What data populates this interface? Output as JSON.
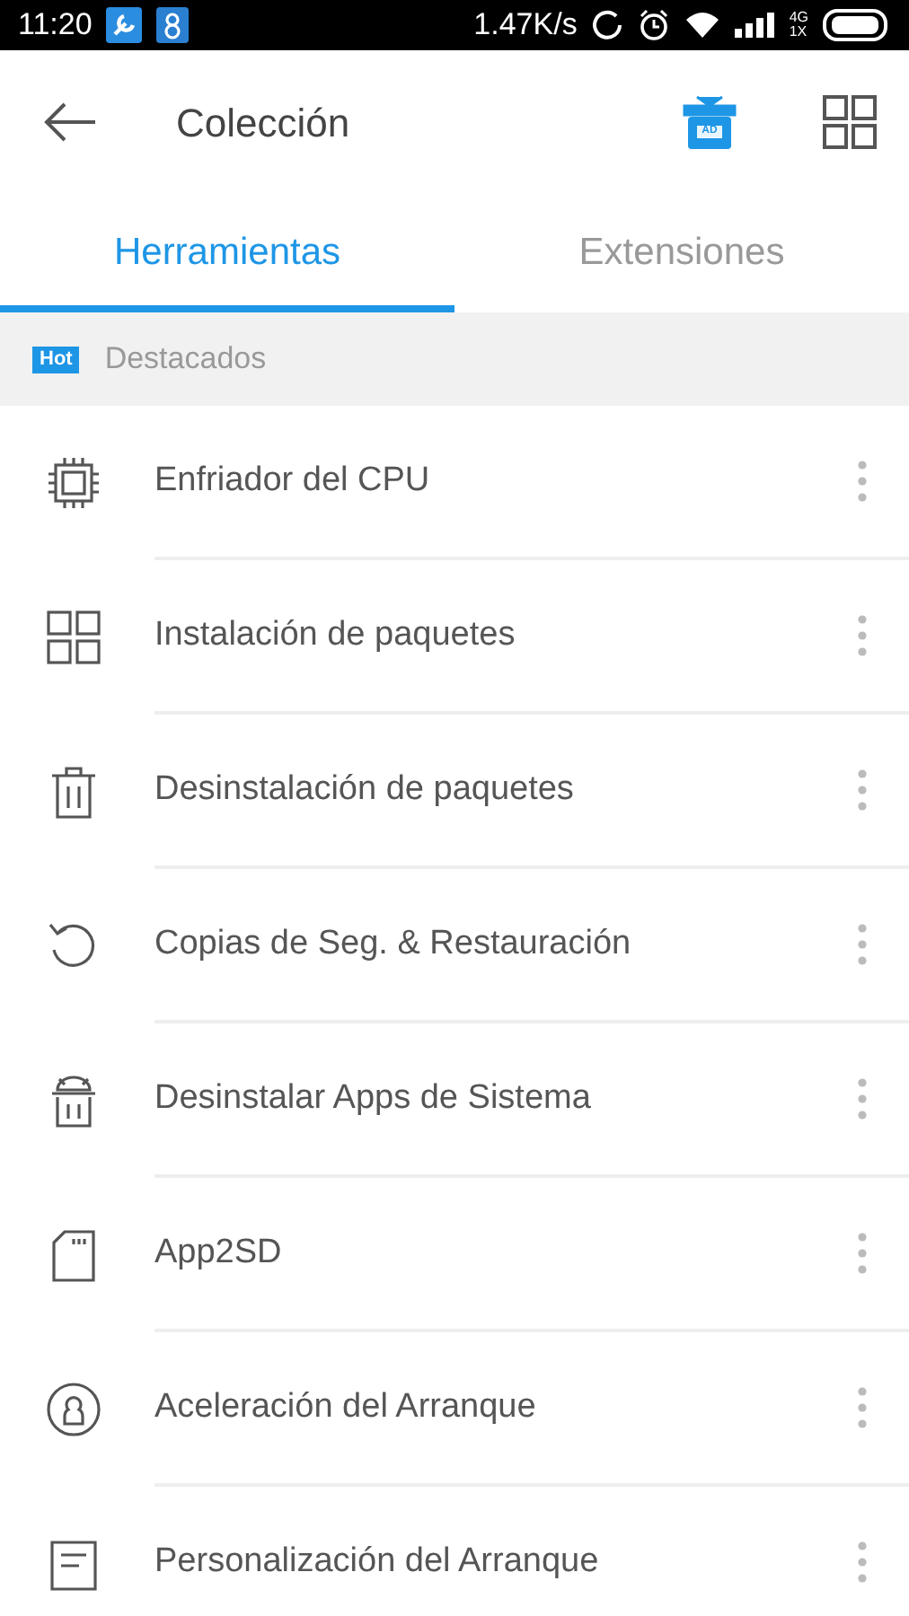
{
  "status_bar": {
    "time": "11:20",
    "speed": "1.47K/s",
    "network_top": "4G",
    "network_bottom": "1X"
  },
  "toolbar": {
    "title": "Colección",
    "gift_label": "AD"
  },
  "tabs": [
    {
      "label": "Herramientas",
      "selected": true
    },
    {
      "label": "Extensiones",
      "selected": false
    }
  ],
  "section": {
    "badge": "Hot",
    "title": "Destacados"
  },
  "items": [
    {
      "label": "Enfriador del CPU"
    },
    {
      "label": "Instalación de paquetes"
    },
    {
      "label": "Desinstalación de paquetes"
    },
    {
      "label": "Copias de Seg. & Restauración"
    },
    {
      "label": "Desinstalar Apps de Sistema"
    },
    {
      "label": "App2SD"
    },
    {
      "label": "Aceleración del Arranque"
    },
    {
      "label": "Personalización del Arranque"
    }
  ]
}
